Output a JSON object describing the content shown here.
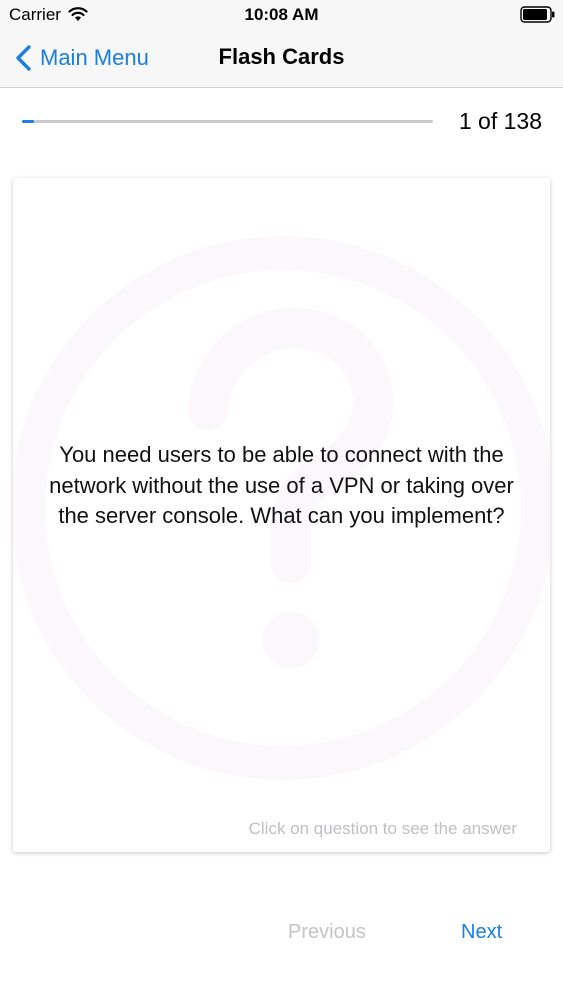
{
  "status_bar": {
    "carrier": "Carrier",
    "time": "10:08 AM",
    "wifi_icon": "wifi-icon",
    "battery_icon": "battery-icon"
  },
  "nav": {
    "back_label": "Main Menu",
    "back_icon": "chevron-left-icon",
    "title": "Flash Cards"
  },
  "progress": {
    "current": 1,
    "total": 138,
    "label": "1 of 138",
    "fraction": 0.00725
  },
  "card": {
    "question": "You need users to be able to connect with the network without the use of a VPN or taking over the server console. What can you implement?",
    "hint": "Click on question to see the answer",
    "watermark_icon": "question-mark-icon"
  },
  "footer": {
    "previous_label": "Previous",
    "next_label": "Next"
  },
  "colors": {
    "accent": "#1a7fe0",
    "disabled": "#c4c4c8",
    "hint": "#bfbfc4"
  }
}
